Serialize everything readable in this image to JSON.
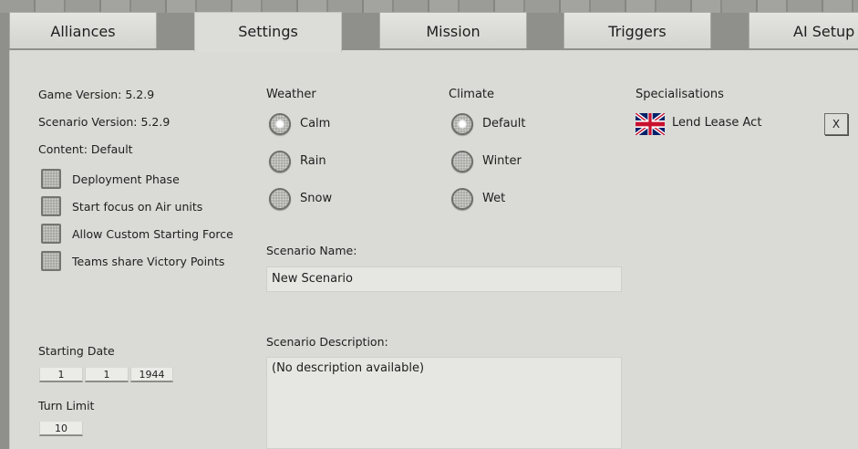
{
  "tabs": [
    {
      "label": "Alliances"
    },
    {
      "label": "Settings"
    },
    {
      "label": "Mission"
    },
    {
      "label": "Triggers"
    },
    {
      "label": "AI Setup"
    }
  ],
  "info": {
    "game_version": "Game Version: 5.2.9",
    "scenario_version": "Scenario Version: 5.2.9",
    "content": "Content: Default"
  },
  "options": [
    {
      "label": "Deployment Phase",
      "checked": false
    },
    {
      "label": "Start focus on Air units",
      "checked": false
    },
    {
      "label": "Allow Custom Starting Force",
      "checked": false
    },
    {
      "label": "Teams share Victory Points",
      "checked": false
    }
  ],
  "weather": {
    "title": "Weather",
    "options": [
      {
        "label": "Calm",
        "selected": true
      },
      {
        "label": "Rain",
        "selected": false
      },
      {
        "label": "Snow",
        "selected": false
      }
    ]
  },
  "climate": {
    "title": "Climate",
    "options": [
      {
        "label": "Default",
        "selected": true
      },
      {
        "label": "Winter",
        "selected": false
      },
      {
        "label": "Wet",
        "selected": false
      }
    ]
  },
  "specialisations": {
    "title": "Specialisations",
    "items": [
      {
        "label": "Lend Lease Act",
        "flag": "union-jack-flag-icon"
      }
    ],
    "remove_label": "X"
  },
  "scenario": {
    "name_label": "Scenario Name:",
    "name_value": "New Scenario",
    "description_label": "Scenario Description:",
    "description_value": "(No description available)"
  },
  "starting_date": {
    "label": "Starting Date",
    "day": "1",
    "month": "1",
    "year": "1944"
  },
  "turn_limit": {
    "label": "Turn Limit",
    "value": "10"
  }
}
